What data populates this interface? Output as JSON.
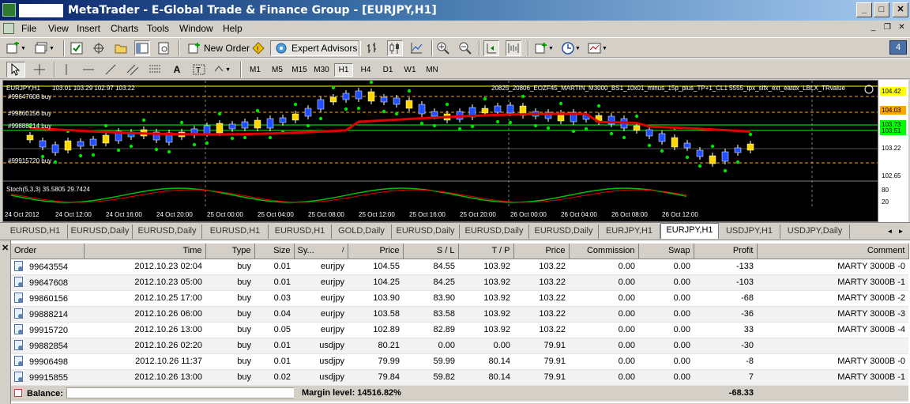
{
  "window": {
    "title": "MetaTrader - E-Global Trade & Finance Group - [EURJPY,H1]"
  },
  "menu": [
    "File",
    "View",
    "Insert",
    "Charts",
    "Tools",
    "Window",
    "Help"
  ],
  "toolbar": {
    "new_order": "New Order",
    "expert_advisors": "Expert Advisors",
    "badge_count": "4"
  },
  "timeframes": [
    "M1",
    "M5",
    "M15",
    "M30",
    "H1",
    "H4",
    "D1",
    "W1",
    "MN"
  ],
  "active_timeframe": "H1",
  "chart": {
    "header_symbol": "EURJPY,H1",
    "header_ohlc": "103.01 103.29 102.97 103.22",
    "header_ea": "20825_20806_EOZF45_MARTIN_M3000_BS1_10x01_minus_15p_plus_TP+1_CL1 5555_tpx_slfx_ext_eatdx_LBLX_TRvalue",
    "order_labels": [
      "#99647608 buy",
      "#99860156 buy",
      "#99888214 buy",
      "#99915720 buy"
    ],
    "stoch_label": "Stoch(5,3,3) 35.5805 29.7424",
    "time_labels": [
      "24 Oct 2012",
      "24 Oct 12:00",
      "24 Oct 16:00",
      "24 Oct 20:00",
      "25 Oct 00:00",
      "25 Oct 04:00",
      "25 Oct 08:00",
      "25 Oct 12:00",
      "25 Oct 16:00",
      "25 Oct 20:00",
      "26 Oct 00:00",
      "26 Oct 04:00",
      "26 Oct 08:00",
      "26 Oct 12:00"
    ],
    "price_badges": [
      {
        "label": "104.42",
        "color": "#ffff00"
      },
      {
        "label": "104.03",
        "color": "#ffa500"
      },
      {
        "label": "103.73",
        "color": "#00ff00"
      },
      {
        "label": "103.51",
        "color": "#00ff00"
      }
    ],
    "price_ticks": [
      "104.42",
      "103.22",
      "102.65"
    ],
    "stoch_ticks": [
      "80",
      "20"
    ]
  },
  "tabs": [
    "EURUSD,H1",
    "EURUSD,Daily",
    "EURUSD,Daily",
    "EURUSD,H1",
    "EURUSD,H1",
    "GOLD,Daily",
    "EURUSD,Daily",
    "EURUSD,Daily",
    "EURUSD,Daily",
    "EURJPY,H1",
    "EURJPY,H1",
    "USDJPY,H1",
    "USDJPY,Daily"
  ],
  "active_tab_index": 10,
  "orders": {
    "columns": [
      "Order",
      "Time",
      "Type",
      "Size",
      "Sy...",
      "Price",
      "S / L",
      "T / P",
      "Price",
      "Commission",
      "Swap",
      "Profit",
      "Comment"
    ],
    "rows": [
      {
        "order": "99643554",
        "time": "2012.10.23 02:04",
        "type": "buy",
        "size": "0.01",
        "symbol": "eurjpy",
        "price": "104.55",
        "sl": "84.55",
        "tp": "103.92",
        "cur": "103.22",
        "commission": "0.00",
        "swap": "0.00",
        "profit": "-133",
        "comment": "MARTY 3000B -0"
      },
      {
        "order": "99647608",
        "time": "2012.10.23 05:00",
        "type": "buy",
        "size": "0.01",
        "symbol": "eurjpy",
        "price": "104.25",
        "sl": "84.25",
        "tp": "103.92",
        "cur": "103.22",
        "commission": "0.00",
        "swap": "0.00",
        "profit": "-103",
        "comment": "MARTY 3000B -1"
      },
      {
        "order": "99860156",
        "time": "2012.10.25 17:00",
        "type": "buy",
        "size": "0.03",
        "symbol": "eurjpy",
        "price": "103.90",
        "sl": "83.90",
        "tp": "103.92",
        "cur": "103.22",
        "commission": "0.00",
        "swap": "0.00",
        "profit": "-68",
        "comment": "MARTY 3000B -2"
      },
      {
        "order": "99888214",
        "time": "2012.10.26 06:00",
        "type": "buy",
        "size": "0.04",
        "symbol": "eurjpy",
        "price": "103.58",
        "sl": "83.58",
        "tp": "103.92",
        "cur": "103.22",
        "commission": "0.00",
        "swap": "0.00",
        "profit": "-36",
        "comment": "MARTY 3000B -3"
      },
      {
        "order": "99915720",
        "time": "2012.10.26 13:00",
        "type": "buy",
        "size": "0.05",
        "symbol": "eurjpy",
        "price": "102.89",
        "sl": "82.89",
        "tp": "103.92",
        "cur": "103.22",
        "commission": "0.00",
        "swap": "0.00",
        "profit": "33",
        "comment": "MARTY 3000B -4"
      },
      {
        "order": "99882854",
        "time": "2012.10.26 02:20",
        "type": "buy",
        "size": "0.01",
        "symbol": "usdjpy",
        "price": "80.21",
        "sl": "0.00",
        "tp": "0.00",
        "cur": "79.91",
        "commission": "0.00",
        "swap": "0.00",
        "profit": "-30",
        "comment": ""
      },
      {
        "order": "99906498",
        "time": "2012.10.26 11:37",
        "type": "buy",
        "size": "0.01",
        "symbol": "usdjpy",
        "price": "79.99",
        "sl": "59.99",
        "tp": "80.14",
        "cur": "79.91",
        "commission": "0.00",
        "swap": "0.00",
        "profit": "-8",
        "comment": "MARTY 3000B -0"
      },
      {
        "order": "99915855",
        "time": "2012.10.26 13:00",
        "type": "buy",
        "size": "0.02",
        "symbol": "usdjpy",
        "price": "79.84",
        "sl": "59.82",
        "tp": "80.14",
        "cur": "79.91",
        "commission": "0.00",
        "swap": "0.00",
        "profit": "7",
        "comment": "MARTY 3000B -1"
      }
    ],
    "balance_label": "Balance:",
    "margin_level": "Margin level: 14516.82%",
    "total_profit": "-68.33"
  }
}
